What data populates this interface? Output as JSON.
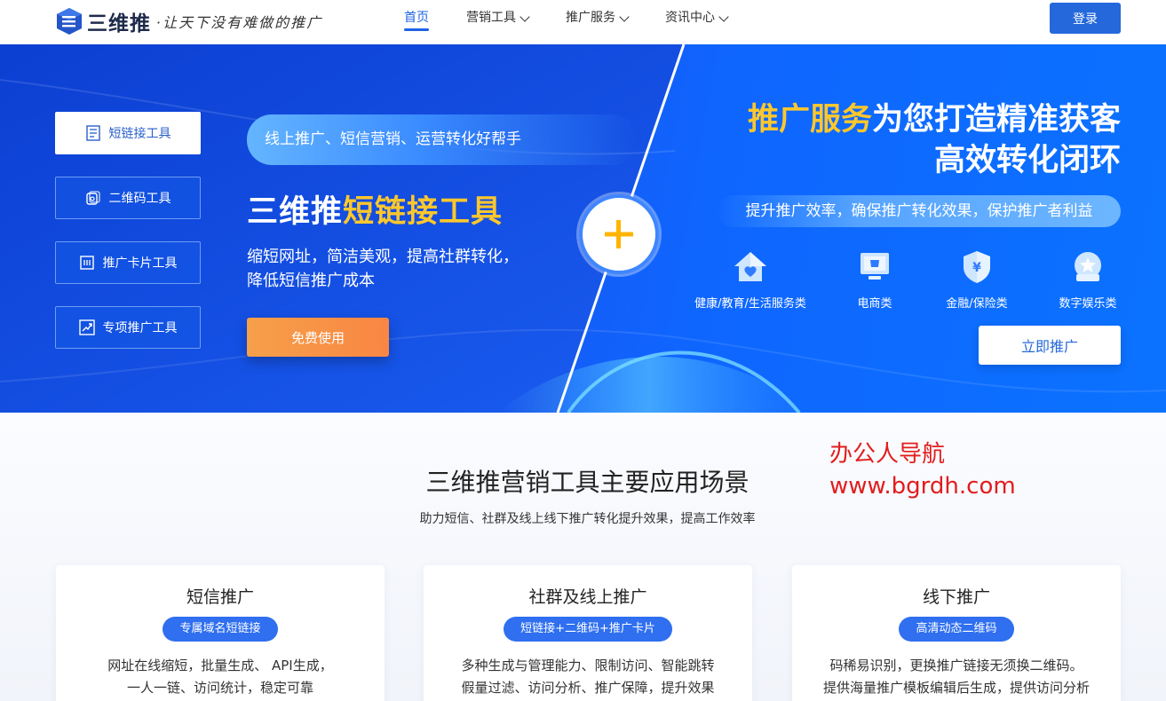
{
  "header": {
    "logo_text": "三维推",
    "slogan": "·让天下没有难做的推广",
    "nav": [
      {
        "label": "首页",
        "active": true,
        "dropdown": false
      },
      {
        "label": "营销工具",
        "active": false,
        "dropdown": true
      },
      {
        "label": "推广服务",
        "active": false,
        "dropdown": true
      },
      {
        "label": "资讯中心",
        "active": false,
        "dropdown": true
      }
    ],
    "login_label": "登录"
  },
  "hero": {
    "side_menu": [
      {
        "label": "短链接工具",
        "icon": "document-icon",
        "active": true
      },
      {
        "label": "二维码工具",
        "icon": "qrcode-icon",
        "active": false
      },
      {
        "label": "推广卡片工具",
        "icon": "card-icon",
        "active": false
      },
      {
        "label": "专项推广工具",
        "icon": "trend-chart-icon",
        "active": false
      }
    ],
    "tagline": "线上推广、短信营销、运营转化好帮手",
    "title_prefix": "三维推",
    "title_highlight": "短链接工具",
    "desc_line1": "缩短网址，简洁美观，提高社群转化，",
    "desc_line2": "降低短信推广成本",
    "free_button": "免费使用",
    "plus_icon": "plus-icon",
    "right_title_highlight": "推广服务",
    "right_title_rest": "为您打造精准获客",
    "right_title_line2": "高效转化闭环",
    "right_pill": "提升推广效率，确保推广转化效果，保护推广者利益",
    "categories": [
      {
        "label": "健康/教育/生活服务类",
        "icon": "house-heart-icon"
      },
      {
        "label": "电商类",
        "icon": "shop-monitor-icon"
      },
      {
        "label": "金融/保险类",
        "icon": "shield-yen-icon"
      },
      {
        "label": "数字娱乐类",
        "icon": "star-badge-icon"
      }
    ],
    "promote_button": "立即推广"
  },
  "section": {
    "title": "三维推营销工具主要应用场景",
    "subtitle": "助力短信、社群及线上线下推广转化提升效果，提高工作效率",
    "watermark_line1": "办公人导航",
    "watermark_line2": "www.bgrdh.com",
    "cards": [
      {
        "title": "短信推广",
        "badge": "专属域名短链接",
        "line1": "网址在线缩短，批量生成、 API生成，",
        "line2": "一人一链、访问统计，稳定可靠"
      },
      {
        "title": "社群及线上推广",
        "badge": "短链接+二维码+推广卡片",
        "line1": "多种生成与管理能力、限制访问、智能跳转",
        "line2": "假量过滤、访问分析、推广保障，提升效果"
      },
      {
        "title": "线下推广",
        "badge": "高清动态二维码",
        "line1": "码稀易识别，更换推广链接无须换二维码。",
        "line2": "提供海量推广模板编辑后生成，提供访问分析"
      }
    ]
  },
  "colors": {
    "primary": "#2468dc",
    "highlight": "#ffc72c",
    "orange": "#f98643",
    "watermark": "#e21d1d"
  }
}
